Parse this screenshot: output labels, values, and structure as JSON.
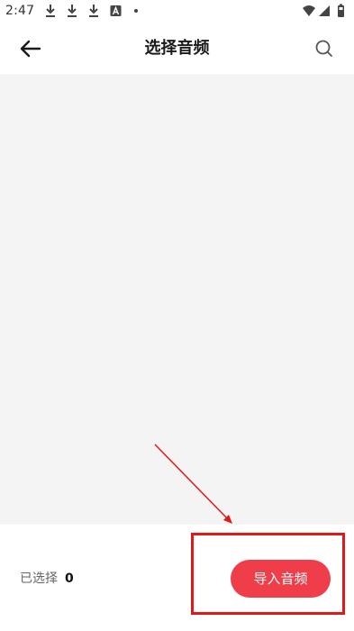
{
  "status_bar": {
    "time": "2:47",
    "icons": [
      "download-icon",
      "download-icon",
      "download-icon",
      "a-app-icon",
      "notification-dot"
    ],
    "right_icons": [
      "wifi-icon",
      "signal-icon",
      "battery-icon"
    ]
  },
  "header": {
    "title": "选择音频",
    "back_icon": "arrow-left-icon",
    "search_icon": "search-icon"
  },
  "footer": {
    "selected_label": "已选择",
    "selected_count": "0",
    "import_label": "导入音频"
  },
  "colors": {
    "accent": "#ef3e4a",
    "content_bg": "#f4f4f4",
    "annotation": "#e01818"
  }
}
